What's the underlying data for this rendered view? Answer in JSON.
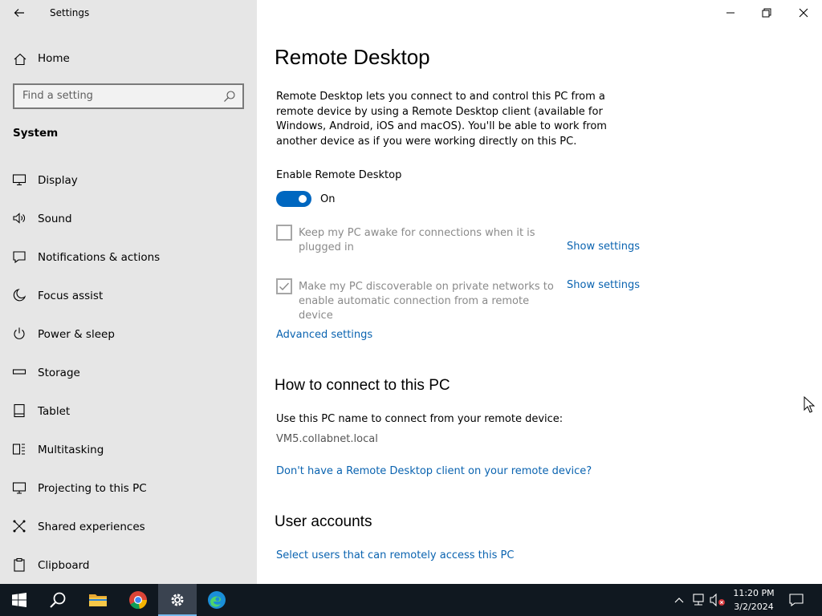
{
  "window": {
    "app_title": "Settings"
  },
  "sidebar": {
    "home_label": "Home",
    "search_placeholder": "Find a setting",
    "section_title": "System",
    "items": [
      {
        "label": "Display",
        "icon": "display-icon"
      },
      {
        "label": "Sound",
        "icon": "sound-icon"
      },
      {
        "label": "Notifications & actions",
        "icon": "notifications-icon"
      },
      {
        "label": "Focus assist",
        "icon": "moon-icon"
      },
      {
        "label": "Power & sleep",
        "icon": "power-icon"
      },
      {
        "label": "Storage",
        "icon": "storage-icon"
      },
      {
        "label": "Tablet",
        "icon": "tablet-icon"
      },
      {
        "label": "Multitasking",
        "icon": "multitasking-icon"
      },
      {
        "label": "Projecting to this PC",
        "icon": "projecting-icon"
      },
      {
        "label": "Shared experiences",
        "icon": "shared-icon"
      },
      {
        "label": "Clipboard",
        "icon": "clipboard-icon"
      }
    ]
  },
  "main": {
    "title": "Remote Desktop",
    "description": "Remote Desktop lets you connect to and control this PC from a remote device by using a Remote Desktop client (available for Windows, Android, iOS and macOS). You'll be able to work from another device as if you were working directly on this PC.",
    "enable_label": "Enable Remote Desktop",
    "toggle_state": "On",
    "toggle_on": true,
    "option_awake": {
      "text": "Keep my PC awake for connections when it is plugged in",
      "checked": false,
      "link": "Show settings"
    },
    "option_discoverable": {
      "text": "Make my PC discoverable on private networks to enable automatic connection from a remote device",
      "checked": true,
      "link": "Show settings"
    },
    "advanced_link": "Advanced settings",
    "connect_heading": "How to connect to this PC",
    "connect_text": "Use this PC name to connect from your remote device:",
    "pc_name": "VM5.collabnet.local",
    "client_link": "Don't have a Remote Desktop client on your remote device?",
    "users_heading": "User accounts",
    "users_link": "Select users that can remotely access this PC"
  },
  "taskbar": {
    "time": "11:20 PM",
    "date": "3/2/2024",
    "accent_color": "#0067c0"
  }
}
